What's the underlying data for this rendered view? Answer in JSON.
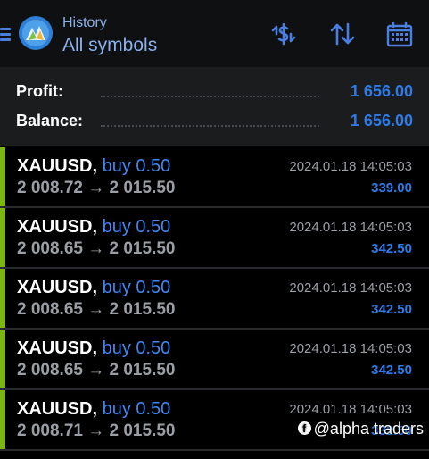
{
  "header": {
    "subtitle": "History",
    "title": "All symbols",
    "accent_color": "#4a7fe0",
    "buttons": [
      {
        "name": "dollar-exchange-icon"
      },
      {
        "name": "sort-icon"
      },
      {
        "name": "calendar-icon"
      }
    ]
  },
  "summary": {
    "profit_label": "Profit:",
    "profit_value": "1 656.00",
    "balance_label": "Balance:",
    "balance_value": "1 656.00"
  },
  "deals": [
    {
      "symbol": "XAUUSD,",
      "direction": "buy 0.50",
      "prices": "2 008.72 → 2 015.50",
      "time": "2024.01.18 14:05:03",
      "profit": "339.00"
    },
    {
      "symbol": "XAUUSD,",
      "direction": "buy 0.50",
      "prices": "2 008.65 → 2 015.50",
      "time": "2024.01.18 14:05:03",
      "profit": "342.50"
    },
    {
      "symbol": "XAUUSD,",
      "direction": "buy 0.50",
      "prices": "2 008.65 → 2 015.50",
      "time": "2024.01.18 14:05:03",
      "profit": "342.50"
    },
    {
      "symbol": "XAUUSD,",
      "direction": "buy 0.50",
      "prices": "2 008.65 → 2 015.50",
      "time": "2024.01.18 14:05:03",
      "profit": "342.50"
    },
    {
      "symbol": "XAUUSD,",
      "direction": "buy 0.50",
      "prices": "2 008.71 → 2 015.50",
      "time": "2024.01.18 14:05:03",
      "profit": "332.50"
    }
  ],
  "watermark": {
    "icon": "facebook-icon",
    "text": "@alpha traders"
  }
}
